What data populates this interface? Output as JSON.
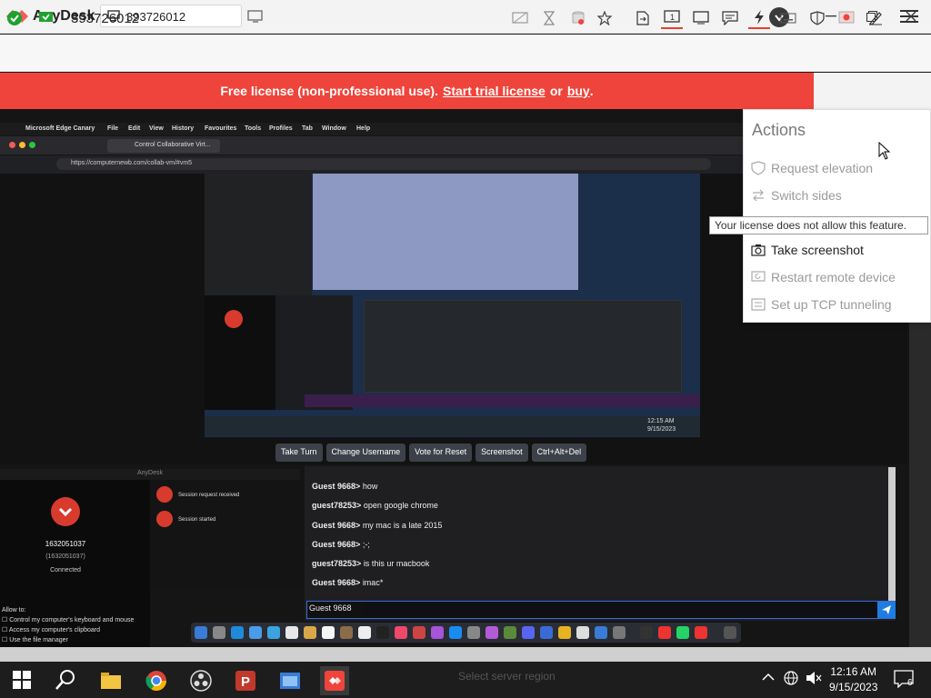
{
  "app": {
    "name": "AnyDesk",
    "tab_label": "393726012"
  },
  "toolbar": {
    "session_id": "393726012"
  },
  "banner": {
    "text": "Free license (non-professional use).",
    "trial_link": "Start trial license",
    "or": "or",
    "buy_link": "buy",
    "end": ".",
    "color": "#ef443b"
  },
  "actions_menu": {
    "title": "Actions",
    "items": [
      {
        "label": "Request elevation",
        "icon": "shield-icon",
        "enabled": false
      },
      {
        "label": "Switch sides",
        "icon": "swap-icon",
        "enabled": false
      },
      {
        "label": "Take screenshot",
        "icon": "camera-icon",
        "enabled": true
      },
      {
        "label": "Restart remote device",
        "icon": "restart-icon",
        "enabled": false
      },
      {
        "label": "Set up TCP tunneling",
        "icon": "tunnel-icon",
        "enabled": false
      }
    ],
    "tooltip": "Your license does not allow this feature."
  },
  "remote": {
    "mac_menu": [
      "Microsoft Edge Canary",
      "File",
      "Edit",
      "View",
      "History",
      "Favourites",
      "Tools",
      "Profiles",
      "Tab",
      "Window",
      "Help"
    ],
    "browser_tab": "Control Collaborative Virt...",
    "url": "https://computernewb.com/collab-vm/#vm5",
    "vm_buttons": [
      "Take Turn",
      "Change Username",
      "Vote for Reset",
      "Screenshot",
      "Ctrl+Alt+Del"
    ],
    "vm_time": "12:15 AM",
    "vm_date": "9/15/2023",
    "chat": [
      {
        "user": "Guest 9668>",
        "text": "how"
      },
      {
        "user": "guest78253>",
        "text": "open google chrome"
      },
      {
        "user": "Guest 9668>",
        "text": "my mac is a late 2015"
      },
      {
        "user": "Guest 9668>",
        "text": ";-;"
      },
      {
        "user": "guest78253>",
        "text": "is this ur macbook"
      },
      {
        "user": "Guest 9668>",
        "text": "imac*"
      }
    ],
    "chat_name": "Guest 9668",
    "anydesk_panel": {
      "title": "AnyDesk",
      "id": "1632051037",
      "id_paren": "(1632051037)",
      "status": "Connected",
      "log": [
        "Session request received",
        "Session started"
      ],
      "allow_title": "Allow to:",
      "allow_items": [
        "Control my computer's keyboard and mouse",
        "Access my computer's clipboard",
        "Use the file manager"
      ]
    }
  },
  "taskbar": {
    "time": "12:16 AM",
    "date": "9/15/2023",
    "notifications": "6",
    "ghost_text": "Select server region"
  }
}
